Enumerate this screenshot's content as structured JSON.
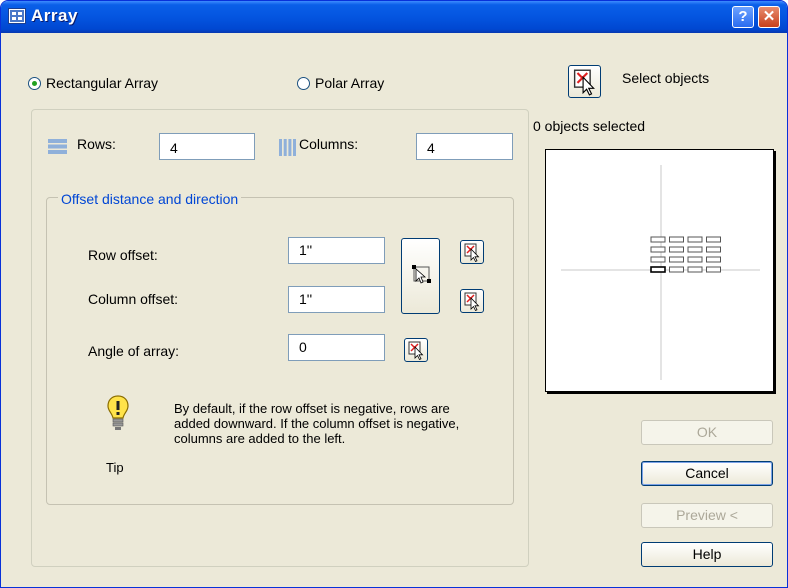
{
  "window": {
    "title": "Array",
    "help_label": "?",
    "close_label": "✕"
  },
  "array_type": {
    "rectangular_label": "Rectangular Array",
    "polar_label": "Polar Array",
    "selected": "rectangular"
  },
  "rows": {
    "label": "Rows:",
    "value": "4"
  },
  "columns": {
    "label": "Columns:",
    "value": "4"
  },
  "offset_group": {
    "title": "Offset distance and direction",
    "row_offset": {
      "label": "Row offset:",
      "value": "1''"
    },
    "column_offset": {
      "label": "Column offset:",
      "value": "1''"
    },
    "angle": {
      "label": "Angle of array:",
      "value": "0"
    }
  },
  "tip": {
    "label": "Tip",
    "text": "By default, if the row offset is negative, rows are added downward.  If the column offset is negative, columns are added to the left."
  },
  "selection": {
    "select_label": "Select objects",
    "status": "0 objects selected"
  },
  "preview": {
    "rows": 4,
    "columns": 4
  },
  "buttons": {
    "ok": "OK",
    "cancel": "Cancel",
    "preview": "Preview <",
    "help": "Help"
  },
  "icons": {
    "app": "array-app-icon",
    "rows": "rows-icon",
    "columns": "columns-icon",
    "pick": "pick-point-icon",
    "pick_both": "pick-both-offsets-icon",
    "tip": "lightbulb-icon"
  }
}
